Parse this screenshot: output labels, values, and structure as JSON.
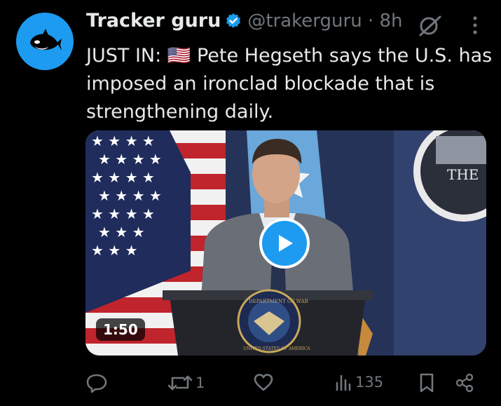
{
  "tweet": {
    "author_name": "Tracker guru",
    "handle_time": "@trakerguru · 8h",
    "text": "JUST IN: 🇺🇸 Pete Hegseth says the U.S. has imposed an ironclad blockade that is strengthening daily.",
    "video": {
      "duration": "1:50",
      "seal_text": "DEPARTMENT OF WAR",
      "seal_bottom_text": "UNITED STATES OF AMERICA",
      "backdrop_text": "THE"
    },
    "actions": {
      "reply_count": "",
      "repost_count": "1",
      "like_count": "",
      "views_count": "135"
    }
  },
  "colors": {
    "background": "#000000",
    "accent": "#1d9bf0",
    "text": "#e7e9ea",
    "secondary_text": "#71767b"
  },
  "icons": {
    "avatar": "orca-icon",
    "verified": "verified-badge-icon",
    "grok": "grok-icon",
    "more": "more-icon",
    "play": "play-icon",
    "reply": "reply-icon",
    "repost": "repost-icon",
    "like": "heart-icon",
    "views": "views-icon",
    "bookmark": "bookmark-icon",
    "share": "share-icon"
  }
}
